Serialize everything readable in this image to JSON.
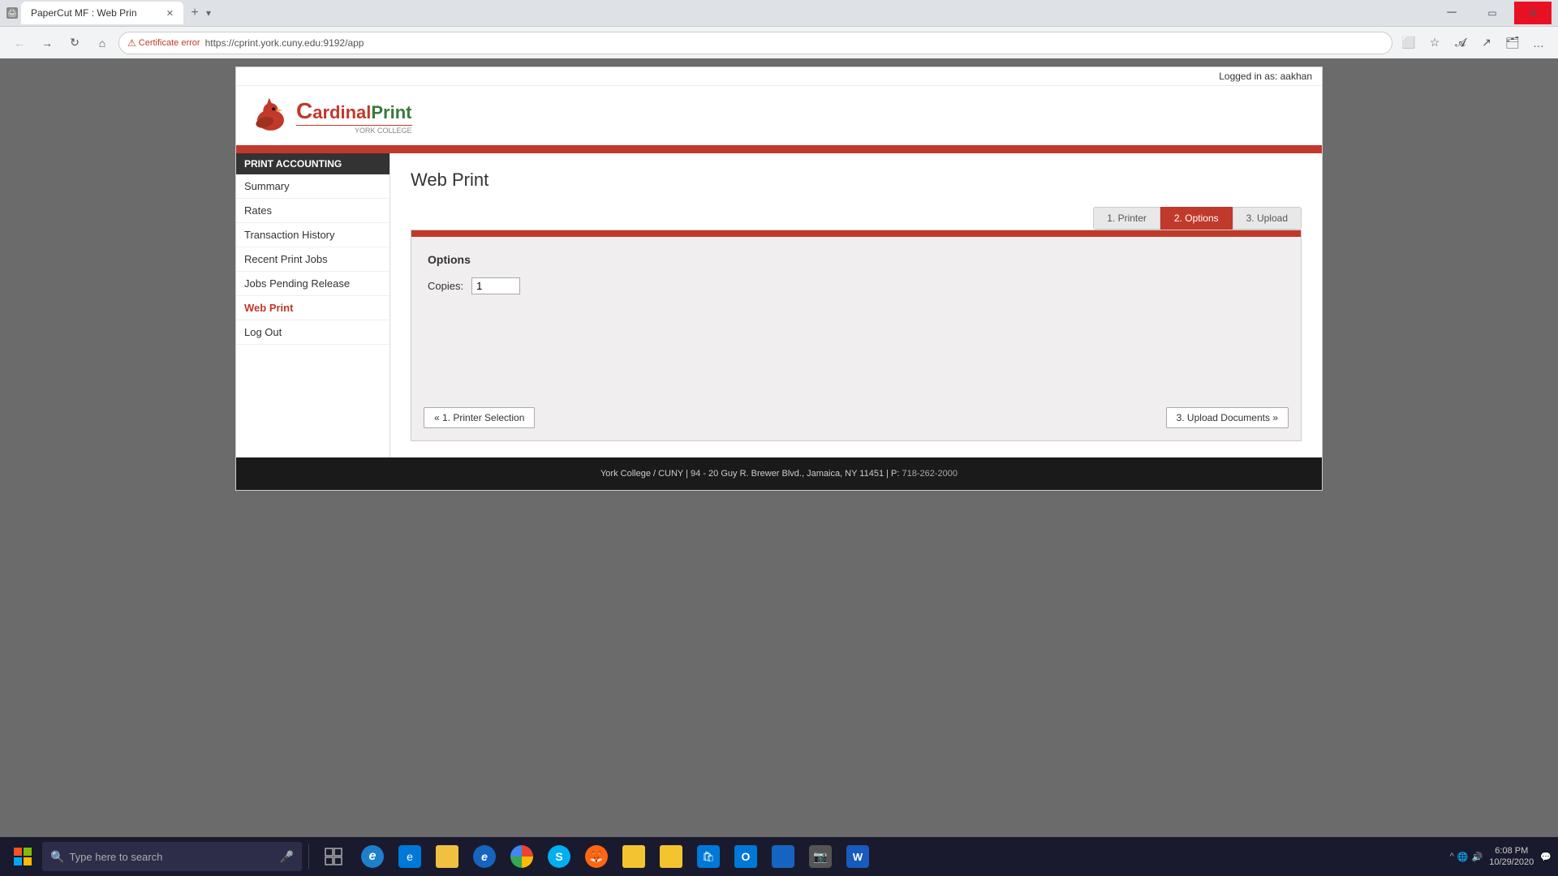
{
  "browser": {
    "tab_title": "PaperCut MF : Web Prin",
    "tab_favicon": "🖨",
    "cert_error": "Certificate error",
    "url": "https://cprint.york.cuny.edu:9192/app",
    "new_tab_btn": "+",
    "nav_back": "←",
    "nav_forward": "→",
    "nav_reload": "↻",
    "nav_home": "⌂"
  },
  "topbar": {
    "logged_in_label": "Logged in as:  aakhan"
  },
  "header": {
    "logo_cardinal": "C",
    "logo_text_cardinal": "ardinal",
    "logo_print": "Print",
    "logo_sub": "YORK COLLEGE"
  },
  "sidebar": {
    "header_label": "PRINT ACCOUNTING",
    "items": [
      {
        "label": "Summary",
        "active": false
      },
      {
        "label": "Rates",
        "active": false
      },
      {
        "label": "Transaction History",
        "active": false
      },
      {
        "label": "Recent Print Jobs",
        "active": false
      },
      {
        "label": "Jobs Pending Release",
        "active": false
      },
      {
        "label": "Web Print",
        "active": true
      },
      {
        "label": "Log Out",
        "active": false
      }
    ]
  },
  "main": {
    "page_title": "Web Print",
    "step_tabs": [
      {
        "label": "1. Printer",
        "active": false
      },
      {
        "label": "2. Options",
        "active": true
      },
      {
        "label": "3. Upload",
        "active": false
      }
    ],
    "panel": {
      "options_title": "Options",
      "copies_label": "Copies:",
      "copies_value": "1",
      "btn_back": "« 1. Printer Selection",
      "btn_next": "3. Upload Documents »"
    }
  },
  "footer": {
    "text": "York College / CUNY | 94 - 20 Guy R. Brewer Blvd., Jamaica, NY 11451 | P: ",
    "phone": "718-262-2000"
  },
  "taskbar": {
    "search_placeholder": "Type here to search",
    "time": "6:08 PM",
    "date": "10/29/2020"
  }
}
